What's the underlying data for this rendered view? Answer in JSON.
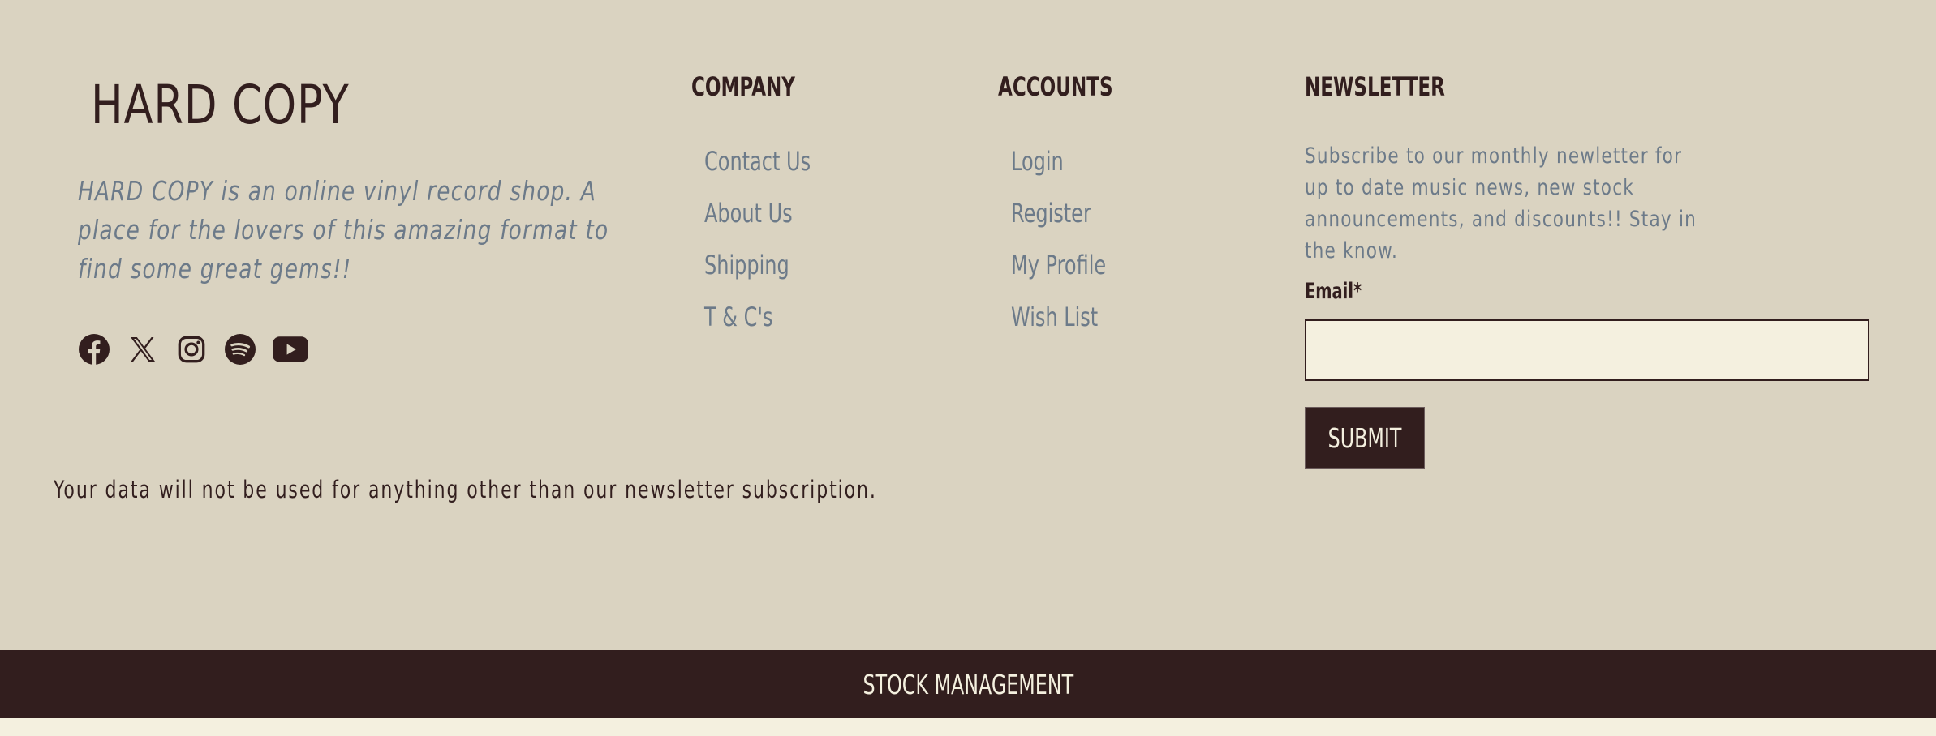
{
  "brand": {
    "name": "HARD COPY",
    "tagline": "HARD COPY is an online vinyl record shop. A place for the lovers of this amazing format to find some great gems!!"
  },
  "social": [
    {
      "icon": "facebook-icon"
    },
    {
      "icon": "x-icon"
    },
    {
      "icon": "instagram-icon"
    },
    {
      "icon": "spotify-icon"
    },
    {
      "icon": "youtube-icon"
    }
  ],
  "company": {
    "heading": "COMPANY",
    "links": [
      "Contact Us",
      "About Us",
      "Shipping",
      "T & C's"
    ]
  },
  "accounts": {
    "heading": "ACCOUNTS",
    "links": [
      "Login",
      "Register",
      "My Profile",
      "Wish List"
    ]
  },
  "newsletter": {
    "heading": "NEWSLETTER",
    "text": "Subscribe to our monthly newletter for up to date music news, new stock announcements, and discounts!! Stay in the know.",
    "email_label": "Email*",
    "email_value": "",
    "submit_label": "SUBMIT"
  },
  "disclaimer": "Your data will not be used for anything other than our newsletter subscription.",
  "stock_bar": {
    "label": "STOCK MANAGEMENT"
  },
  "colors": {
    "footer_bg": "#dad3c1",
    "page_bg": "#f4f0df",
    "dark": "#321e1e",
    "muted_text": "#6c7a89"
  }
}
